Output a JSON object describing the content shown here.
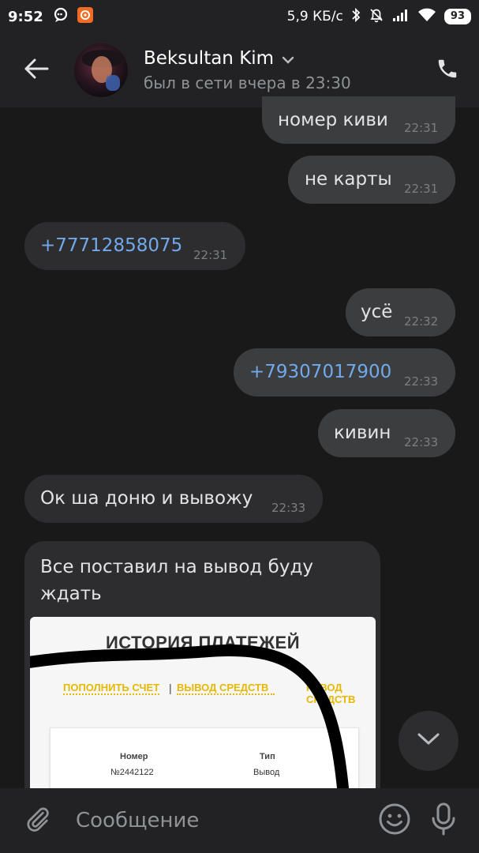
{
  "status_bar": {
    "time": "9:52",
    "network_speed": "5,9 КБ/с",
    "battery": "93",
    "icons": [
      "chat-bubble-icon",
      "app-badge-icon",
      "bluetooth-icon",
      "silent-icon",
      "signal-icon",
      "wifi-icon",
      "battery-icon"
    ]
  },
  "header": {
    "contact_name": "Beksultan Kim",
    "last_seen": "был в сети вчера в 23:30",
    "icons": [
      "back-arrow-icon",
      "chevron-down-icon",
      "phone-icon"
    ]
  },
  "messages": [
    {
      "direction": "out",
      "text": "номер киви",
      "time": "22:31"
    },
    {
      "direction": "out",
      "text": "не карты",
      "time": "22:31"
    },
    {
      "direction": "in",
      "text": "+77712858075",
      "time": "22:31",
      "is_link": true
    },
    {
      "direction": "out",
      "text": "усё",
      "time": "22:32"
    },
    {
      "direction": "out",
      "text": "+79307017900",
      "time": "22:33",
      "is_link": true
    },
    {
      "direction": "out",
      "text": "кивин",
      "time": "22:33"
    },
    {
      "direction": "in",
      "text": "Ок ша доню и вывожу",
      "time": "22:33"
    }
  ],
  "photo_message": {
    "direction": "in",
    "caption_line1": "Все поставил на вывод буду",
    "caption_line2": "ждать",
    "screenshot": {
      "heading": "ИСТОРИЯ ПЛАТЕЖЕЙ",
      "link_topup": "ПОПОЛНИТЬ СЧЕТ",
      "separator": "|",
      "link_withdraw": "ВЫВОД СРЕДСТВ",
      "link_transfer_visible": "РЕВОД СРЕДСТВ",
      "col_number_label": "Номер",
      "col_number_value": "№2442122",
      "col_type_label": "Тип",
      "col_type_value": "Вывод"
    }
  },
  "composer": {
    "placeholder": "Сообщение",
    "icons": [
      "attach-icon",
      "emoji-icon",
      "mic-icon"
    ]
  },
  "colors": {
    "background": "#19191a",
    "bar": "#222224",
    "bubble_out": "#3c3d3f",
    "bubble_in": "#2d2d2f",
    "link": "#71aaeb",
    "secondary_text": "#8f9296"
  }
}
